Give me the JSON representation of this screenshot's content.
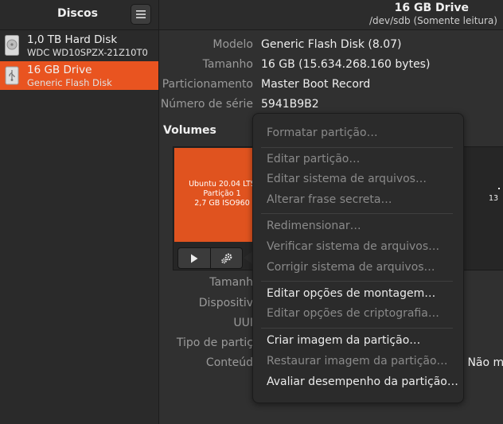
{
  "sidebar": {
    "title": "Discos",
    "disks": [
      {
        "name": "1,0 TB Hard Disk",
        "subtitle": "WDC WD10SPZX-21Z10T0",
        "icon": "hard-disk-icon",
        "selected": false
      },
      {
        "name": "16 GB Drive",
        "subtitle": "Generic Flash Disk",
        "icon": "usb-drive-icon",
        "selected": true
      }
    ]
  },
  "header": {
    "title": "16 GB Drive",
    "subtitle": "/dev/sdb (Somente leitura)"
  },
  "drive_props": [
    {
      "label": "Modelo",
      "value": "Generic Flash Disk (8.07)"
    },
    {
      "label": "Tamanho",
      "value": "16 GB (15.634.268.160 bytes)"
    },
    {
      "label": "Particionamento",
      "value": "Master Boot Record"
    },
    {
      "label": "Número de série",
      "value": "5941B9B2"
    }
  ],
  "volumes": {
    "heading": "Volumes",
    "partition": {
      "line1": "Ubuntu 20.04 LTS",
      "line2": "Partição 1",
      "line3": "2,7 GB ISO960"
    },
    "free_space_fragment": "13",
    "partition_color": "#e0531f"
  },
  "volume_props": [
    {
      "label": "Tamanh"
    },
    {
      "label": "Dispositiv"
    },
    {
      "label": "UUI"
    },
    {
      "label": "Tipo de partiç"
    },
    {
      "label": "Conteúd",
      "value_fragment": "– Não m"
    }
  ],
  "menu": {
    "items": [
      {
        "label": "Formatar partição…",
        "enabled": false
      },
      {
        "label": "Editar partição…",
        "enabled": false
      },
      {
        "label": "Editar sistema de arquivos…",
        "enabled": false
      },
      {
        "label": "Alterar frase secreta…",
        "enabled": false
      },
      {
        "label": "Redimensionar…",
        "enabled": false
      },
      {
        "label": "Verificar sistema de arquivos…",
        "enabled": false
      },
      {
        "label": "Corrigir sistema de arquivos…",
        "enabled": false
      },
      {
        "label": "Editar opções de montagem…",
        "enabled": true
      },
      {
        "label": "Editar opções de criptografia…",
        "enabled": false
      },
      {
        "label": "Criar imagem da partição…",
        "enabled": true
      },
      {
        "label": "Restaurar imagem da partição…",
        "enabled": false
      },
      {
        "label": "Avaliar desempenho da partição…",
        "enabled": true
      }
    ]
  },
  "colors": {
    "accent": "#e95420",
    "background": "#303030",
    "sidebar": "#2a2a2a"
  }
}
